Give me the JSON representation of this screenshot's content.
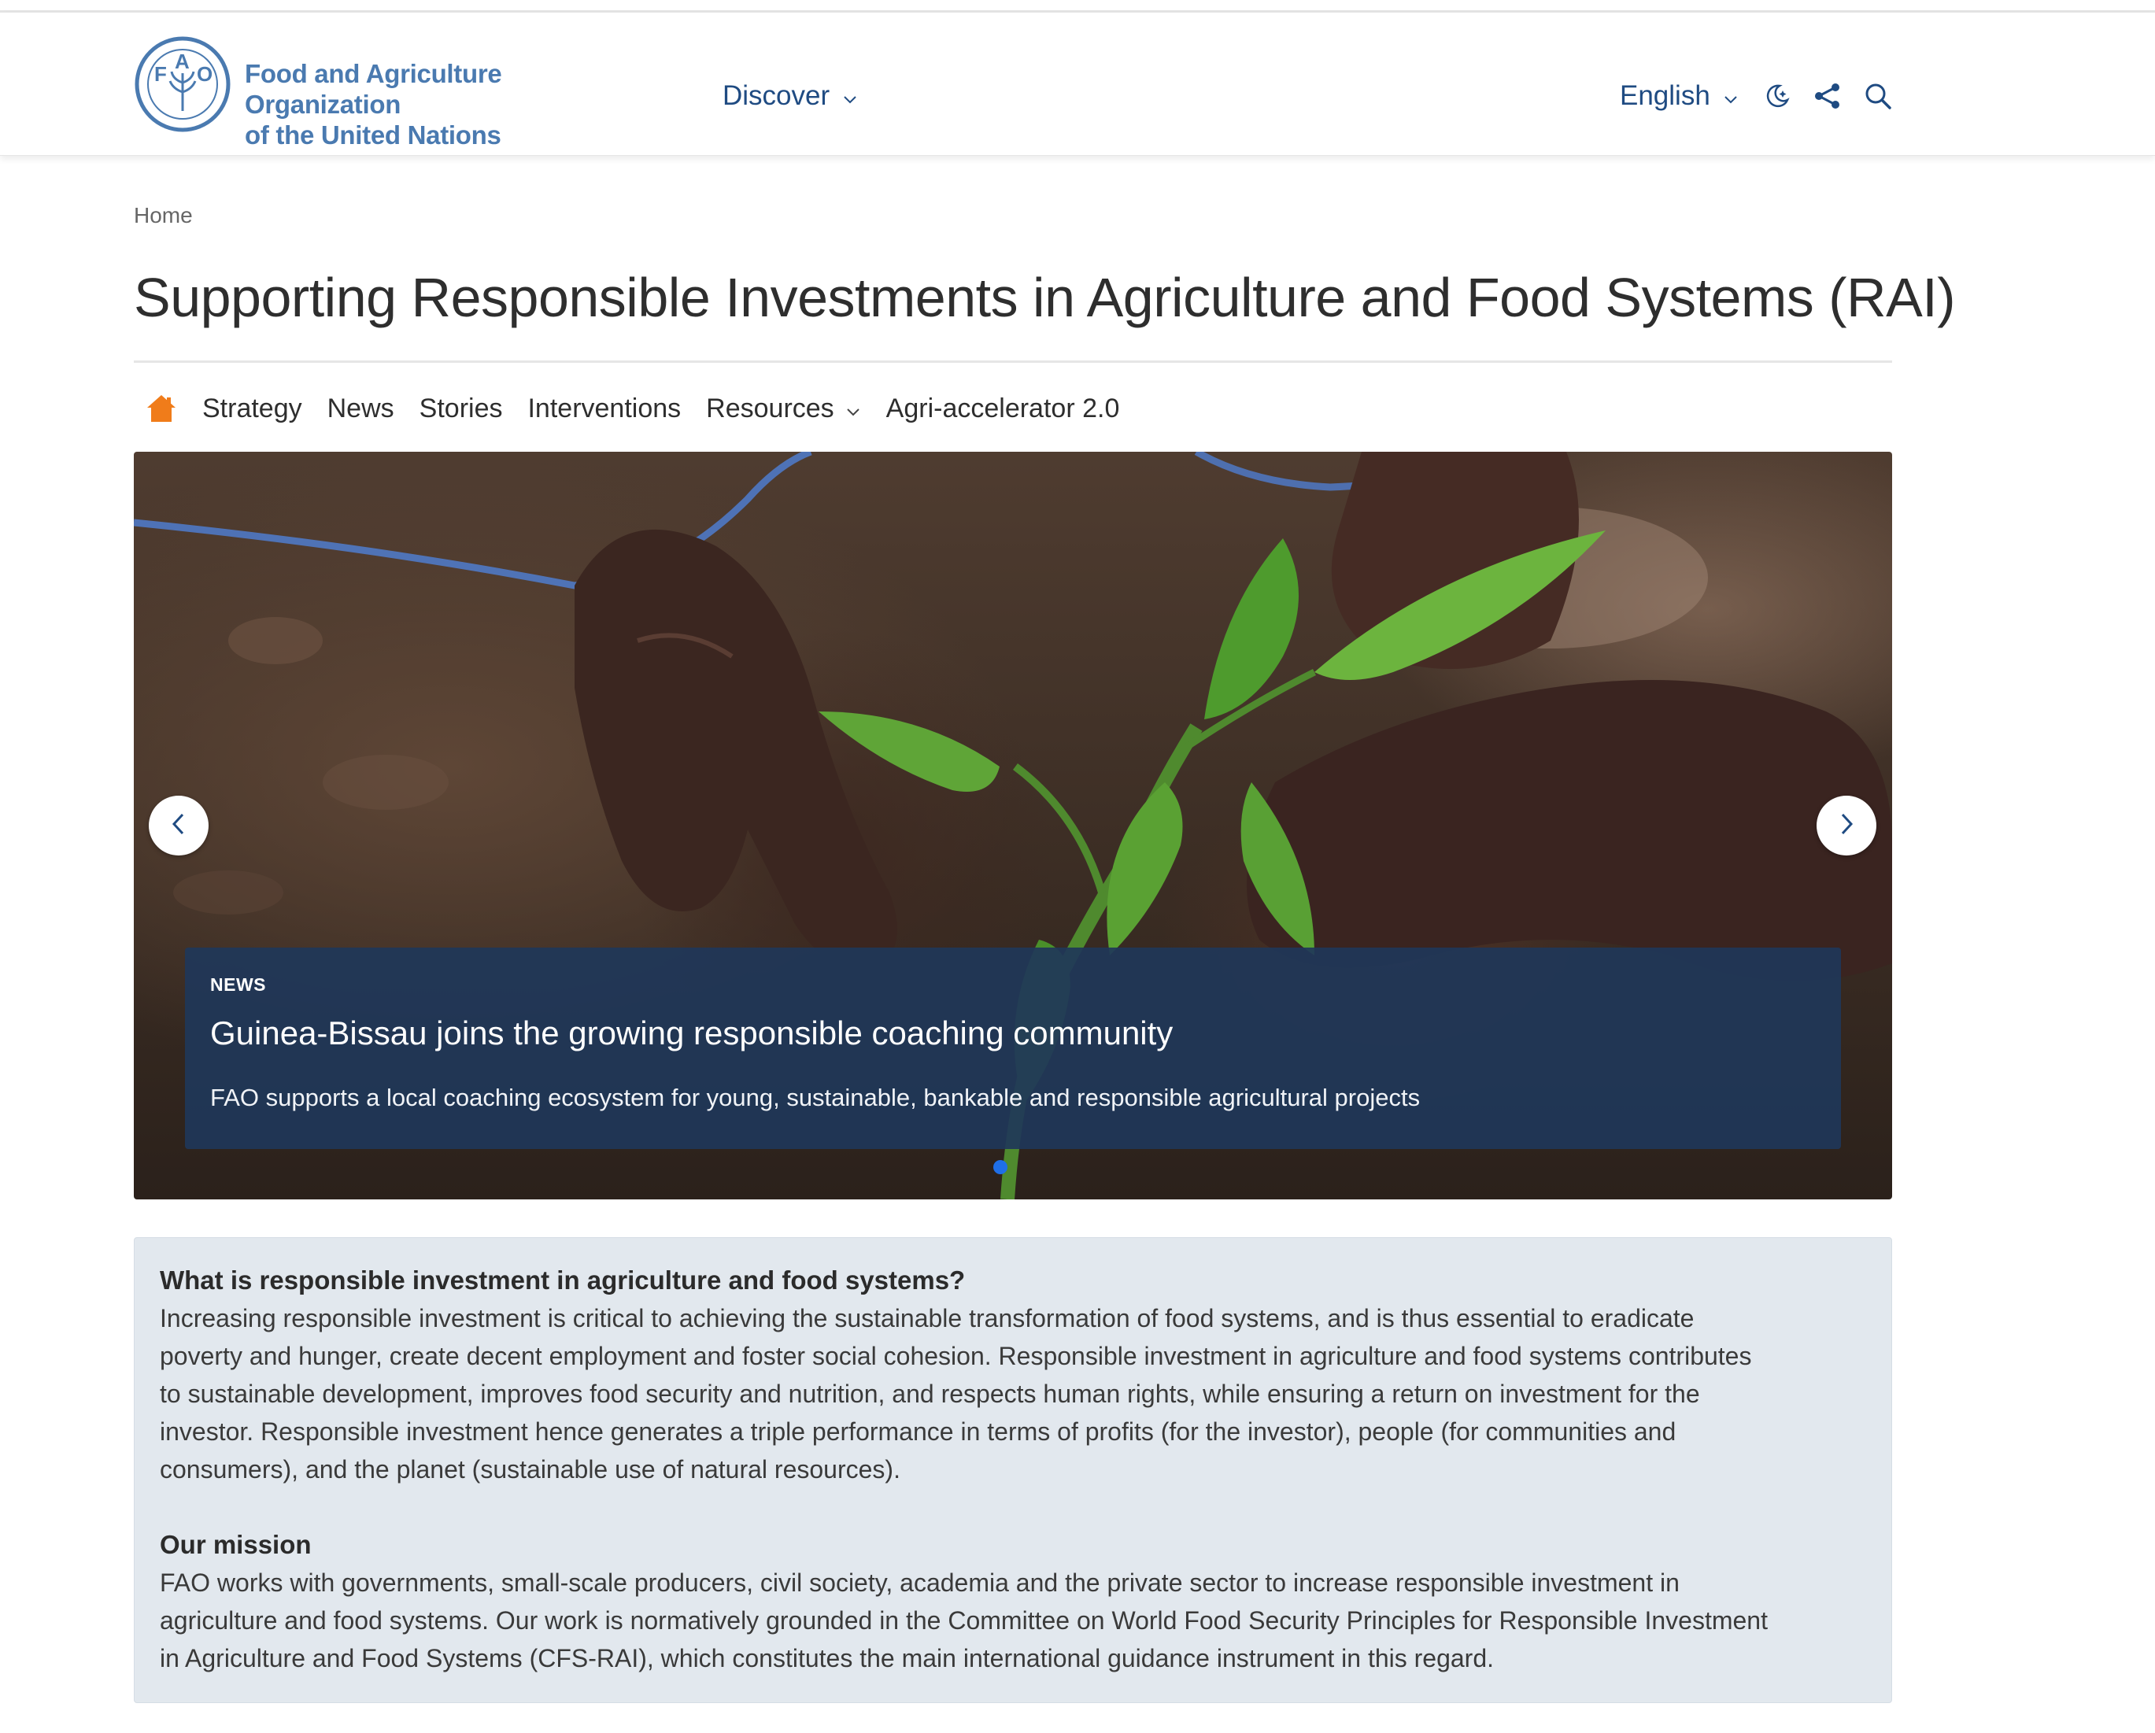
{
  "header": {
    "org_name_line1": "Food and Agriculture Organization",
    "org_name_line2": "of the United Nations",
    "discover_label": "Discover",
    "language_label": "English",
    "brand_color": "#4a7ab0",
    "nav_color": "#1f4b82"
  },
  "breadcrumb": {
    "home": "Home"
  },
  "page": {
    "title": "Supporting Responsible Investments in Agriculture and Food Systems (RAI)"
  },
  "subnav": {
    "home_icon": "home-icon",
    "items": [
      {
        "label": "Strategy"
      },
      {
        "label": "News"
      },
      {
        "label": "Stories"
      },
      {
        "label": "Interventions"
      },
      {
        "label": "Resources"
      },
      {
        "label": "Agri-accelerator 2.0"
      }
    ],
    "home_icon_color": "#f07c1a"
  },
  "carousel": {
    "slide": {
      "tag": "NEWS",
      "headline": "Guinea-Bissau joins the growing responsible coaching community",
      "summary": "FAO supports a local coaching ecosystem for young, sustainable, bankable and responsible agricultural projects"
    },
    "active_dot_color": "#1f6fe8"
  },
  "info": {
    "q_heading": "What is responsible investment in agriculture and food systems?",
    "q_lines": [
      "Increasing responsible investment is critical to achieving the sustainable transformation of food systems, and is thus essential to eradicate",
      "poverty and hunger, create decent employment and foster social cohesion. Responsible investment in agriculture and food systems contributes",
      "to sustainable development, improves food security and nutrition, and respects human rights, while ensuring a return on investment for the",
      "investor. Responsible investment hence generates a triple performance in terms of profits (for the investor), people (for communities and",
      "consumers), and the planet (sustainable use of natural resources)."
    ],
    "mission_heading": "Our mission",
    "mission_lines": [
      "FAO works with governments, small-scale producers, civil society, academia and the private sector to increase responsible investment in",
      "agriculture and food systems. Our work is normatively grounded in the Committee on World Food Security Principles for Responsible Investment",
      "in Agriculture and Food Systems (CFS-RAI), which constitutes the main international guidance instrument in this regard."
    ]
  }
}
